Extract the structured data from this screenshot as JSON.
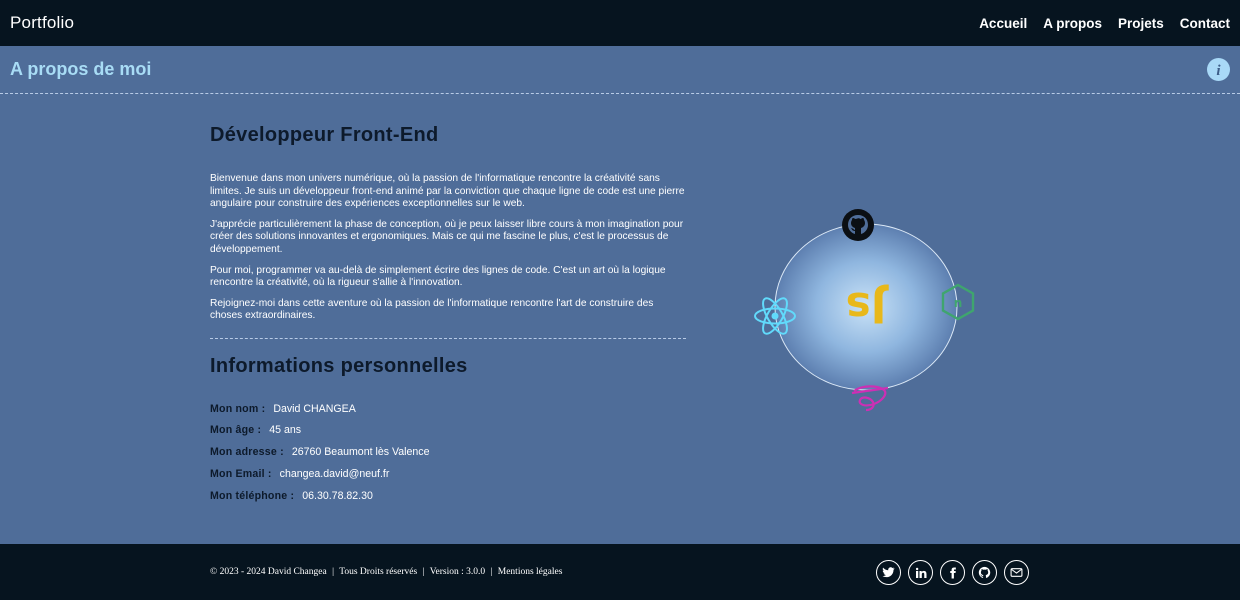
{
  "navbar": {
    "brand": "Portfolio",
    "links": [
      "Accueil",
      "A propos",
      "Projets",
      "Contact"
    ]
  },
  "section": {
    "title": "A propos de moi",
    "info_icon": "info-icon"
  },
  "about": {
    "heading": "Développeur Front-End",
    "paragraphs": [
      "Bienvenue dans mon univers numérique, où la passion de l'informatique rencontre la créativité sans limites. Je suis un développeur front-end animé par la conviction que chaque ligne de code est une pierre angulaire pour construire des expériences exceptionnelles sur le web.",
      "J'apprécie particulièrement la phase de conception, où je peux laisser libre cours à mon imagination pour créer des solutions innovantes et ergonomiques. Mais ce qui me fascine le plus, c'est le processus de développement.",
      "Pour moi, programmer va au-delà de simplement écrire des lignes de code. C'est un art où la logique rencontre la créativité, où la rigueur s'allie à l'innovation.",
      "Rejoignez-moi dans cette aventure où la passion de l'informatique rencontre l'art de construire des choses extraordinaires."
    ]
  },
  "personal": {
    "heading": "Informations personnelles",
    "rows": [
      {
        "label": "Mon nom :",
        "value": "David CHANGEA"
      },
      {
        "label": "Mon âge :",
        "value": "45 ans"
      },
      {
        "label": "Mon adresse :",
        "value": "26760 Beaumont lès Valence"
      },
      {
        "label": "Mon Email :",
        "value": "changea.david@neuf.fr"
      },
      {
        "label": "Mon téléphone :",
        "value": "06.30.78.82.30"
      }
    ]
  },
  "orbit": {
    "center_logo": "js-icon",
    "icons": [
      "github-icon",
      "react-icon",
      "nodejs-icon",
      "sass-icon"
    ],
    "colors": {
      "js": "#e8b81a",
      "react": "#61dafb",
      "node": "#3fa56e",
      "sass": "#cd2fb4",
      "github": "#0b0f14"
    }
  },
  "footer": {
    "copyright": [
      "© 2023 - 2024 David Changea",
      "|",
      "Tous Droits réservés",
      "|",
      "Version : 3.0.0",
      "|",
      "Mentions légales"
    ],
    "socials": [
      "twitter-icon",
      "linkedin-icon",
      "facebook-icon",
      "github-icon",
      "email-icon"
    ]
  },
  "colors": {
    "background": "#4f6d99",
    "navbar": "#06141f",
    "accent_title": "#a8dcf5",
    "heading_dark": "#0d1a2b"
  }
}
